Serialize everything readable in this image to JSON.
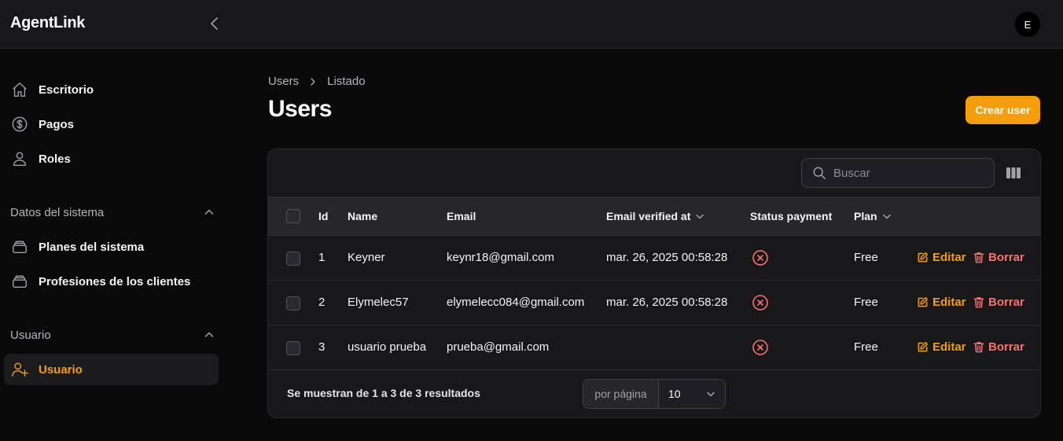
{
  "app": {
    "brand": "AgentLink",
    "avatar_initial": "E"
  },
  "sidebar": {
    "items": [
      {
        "label": "Escritorio",
        "icon": "home-icon"
      },
      {
        "label": "Pagos",
        "icon": "dollar-circle-icon"
      },
      {
        "label": "Roles",
        "icon": "user-icon"
      }
    ],
    "groups": [
      {
        "label": "Datos del sistema",
        "items": [
          {
            "label": "Planes del sistema",
            "icon": "stack-icon"
          },
          {
            "label": "Profesiones de los clientes",
            "icon": "stack-icon"
          }
        ]
      },
      {
        "label": "Usuario",
        "items": [
          {
            "label": "Usuario",
            "icon": "user-plus-icon",
            "active": true
          }
        ]
      }
    ]
  },
  "breadcrumb": {
    "items": [
      "Users",
      "Listado"
    ]
  },
  "page": {
    "title": "Users",
    "create_label": "Crear user"
  },
  "search": {
    "placeholder": "Buscar"
  },
  "table": {
    "columns": {
      "id": "Id",
      "name": "Name",
      "email": "Email",
      "verified": "Email verified at",
      "status": "Status payment",
      "plan": "Plan"
    },
    "rows": [
      {
        "id": "1",
        "name": "Keyner",
        "email": "keynr18@gmail.com",
        "verified": "mar. 26, 2025 00:58:28",
        "status": "x-circle-icon",
        "plan": "Free"
      },
      {
        "id": "2",
        "name": "Elymelec57",
        "email": "elymelecc084@gmail.com",
        "verified": "mar. 26, 2025 00:58:28",
        "status": "x-circle-icon",
        "plan": "Free"
      },
      {
        "id": "3",
        "name": "usuario prueba",
        "email": "prueba@gmail.com",
        "verified": "",
        "status": "x-circle-icon",
        "plan": "Free"
      }
    ],
    "actions": {
      "edit": "Editar",
      "delete": "Borrar"
    }
  },
  "pagination": {
    "summary": "Se muestran de 1 a 3 de 3 resultados",
    "per_page_label": "por página",
    "per_page_value": "10"
  },
  "colors": {
    "accent": "#f59e0b",
    "danger": "#f87171",
    "background": "#0a0a0b",
    "surface": "#18181b"
  }
}
